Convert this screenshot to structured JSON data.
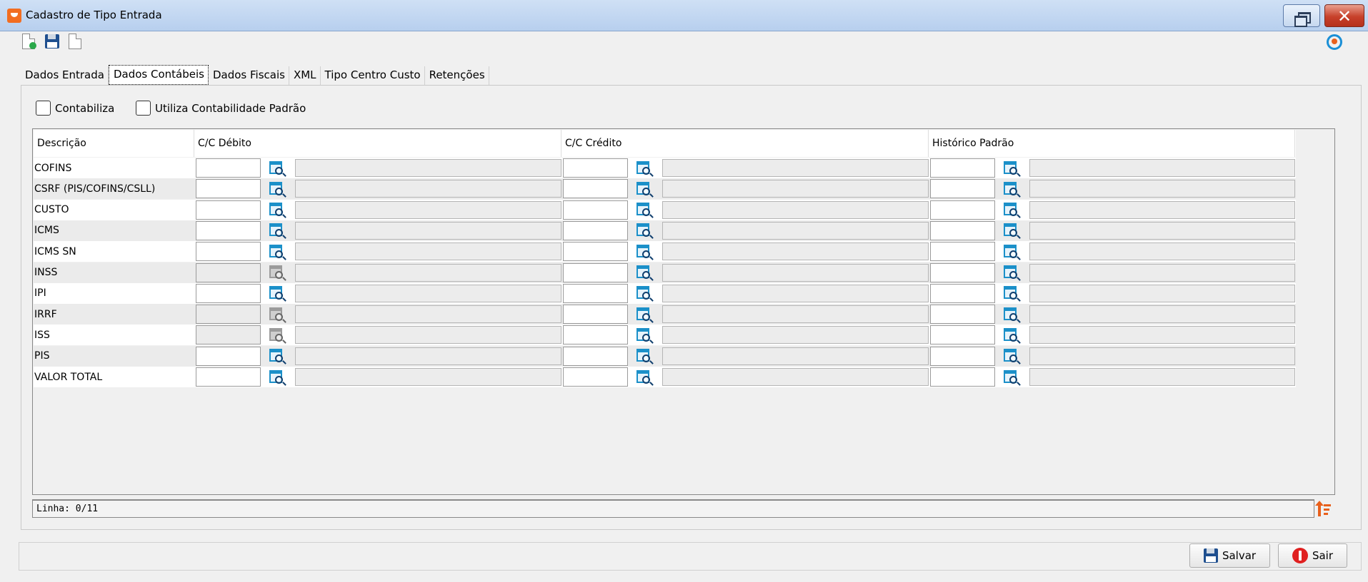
{
  "window": {
    "title": "Cadastro de Tipo Entrada"
  },
  "toolbar": {
    "icons": [
      "new-document-icon",
      "save-icon",
      "copy-document-icon",
      "refresh-icon"
    ]
  },
  "tabs": [
    {
      "label": "Dados Entrada",
      "active": false
    },
    {
      "label": "Dados Contábeis",
      "active": true
    },
    {
      "label": "Dados Fiscais",
      "active": false
    },
    {
      "label": "XML",
      "active": false
    },
    {
      "label": "Tipo Centro Custo",
      "active": false
    },
    {
      "label": "Retenções",
      "active": false
    }
  ],
  "options": {
    "contabiliza": {
      "label": "Contabiliza",
      "checked": false
    },
    "padrao": {
      "label": "Utiliza Contabilidade Padrão",
      "checked": false
    }
  },
  "grid": {
    "headers": {
      "descricao": "Descrição",
      "debito": "C/C Débito",
      "credito": "C/C Crédito",
      "historico": "Histórico Padrão"
    },
    "rows": [
      {
        "descricao": "COFINS",
        "debito_enabled": true
      },
      {
        "descricao": "CSRF (PIS/COFINS/CSLL)",
        "debito_enabled": true
      },
      {
        "descricao": "CUSTO",
        "debito_enabled": true
      },
      {
        "descricao": "ICMS",
        "debito_enabled": true
      },
      {
        "descricao": "ICMS SN",
        "debito_enabled": true
      },
      {
        "descricao": "INSS",
        "debito_enabled": false
      },
      {
        "descricao": "IPI",
        "debito_enabled": true
      },
      {
        "descricao": "IRRF",
        "debito_enabled": false
      },
      {
        "descricao": "ISS",
        "debito_enabled": false
      },
      {
        "descricao": "PIS",
        "debito_enabled": true
      },
      {
        "descricao": "VALOR TOTAL",
        "debito_enabled": true
      }
    ]
  },
  "status": {
    "text": "Linha: 0/11"
  },
  "buttons": {
    "salvar": "Salvar",
    "sair": "Sair"
  },
  "colors": {
    "accent_orange": "#e8601c",
    "lookup_blue": "#1b90c9",
    "close_red": "#c7402a"
  }
}
